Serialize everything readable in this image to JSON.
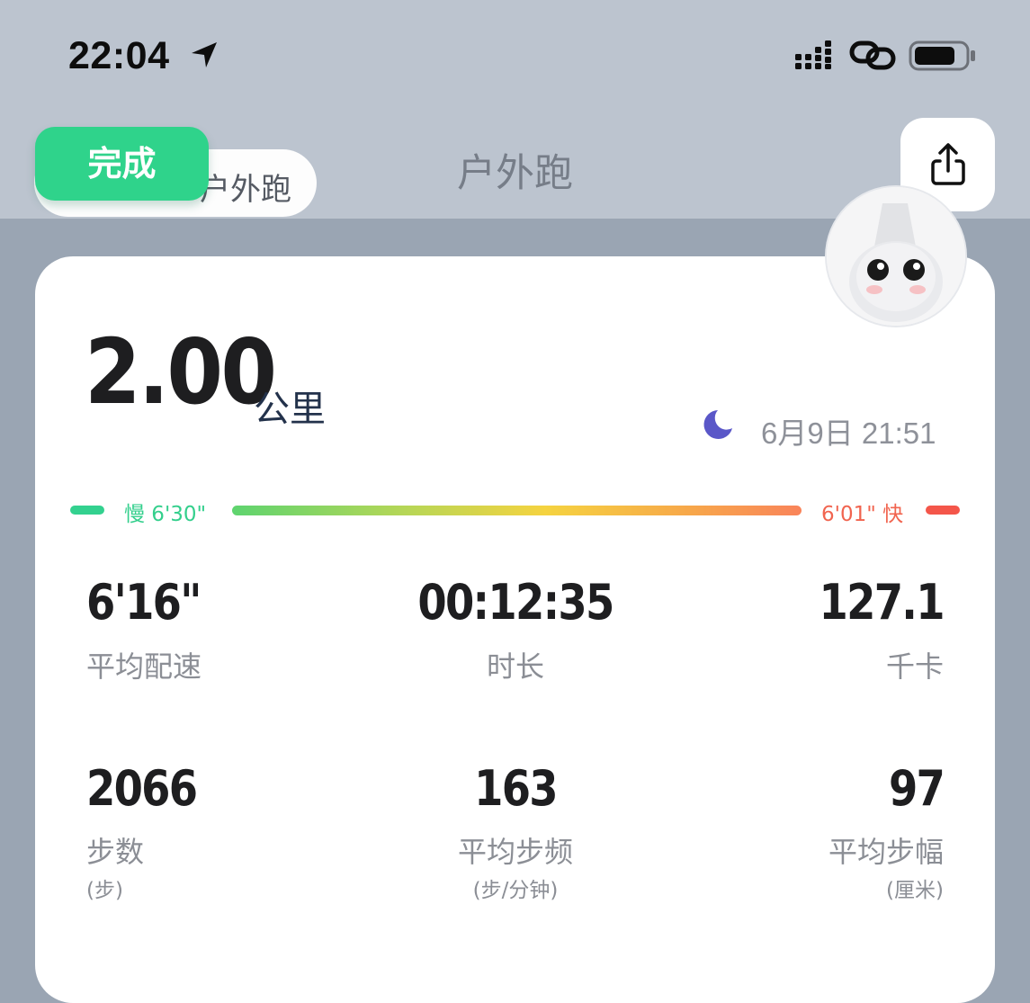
{
  "status_bar": {
    "time": "22:04"
  },
  "header": {
    "done_label": "完成",
    "mode_label": "户外跑",
    "title": "户外跑"
  },
  "summary": {
    "distance": "2.00",
    "distance_unit": "公里",
    "datetime": "6月9日 21:51"
  },
  "pace_range": {
    "slow": "慢 6'30\"",
    "fast": "6'01\" 快"
  },
  "stats": [
    {
      "value": "6'16\"",
      "label": "平均配速",
      "sub": ""
    },
    {
      "value": "00:12:35",
      "label": "时长",
      "sub": ""
    },
    {
      "value": "127.1",
      "label": "千卡",
      "sub": ""
    },
    {
      "value": "2066",
      "label": "步数",
      "sub": "(步)"
    },
    {
      "value": "163",
      "label": "平均步频",
      "sub": "(步/分钟)"
    },
    {
      "value": "97",
      "label": "平均步幅",
      "sub": "(厘米)"
    }
  ],
  "colors": {
    "accent_green": "#2fd38b",
    "pace_slow": "#33cf8c",
    "pace_fast": "#f1644f",
    "moon": "#5a57c8"
  },
  "icons": [
    "location-arrow-icon",
    "signal-icon",
    "link-icon",
    "battery-icon",
    "share-icon",
    "moon-icon",
    "mascot-avatar"
  ]
}
